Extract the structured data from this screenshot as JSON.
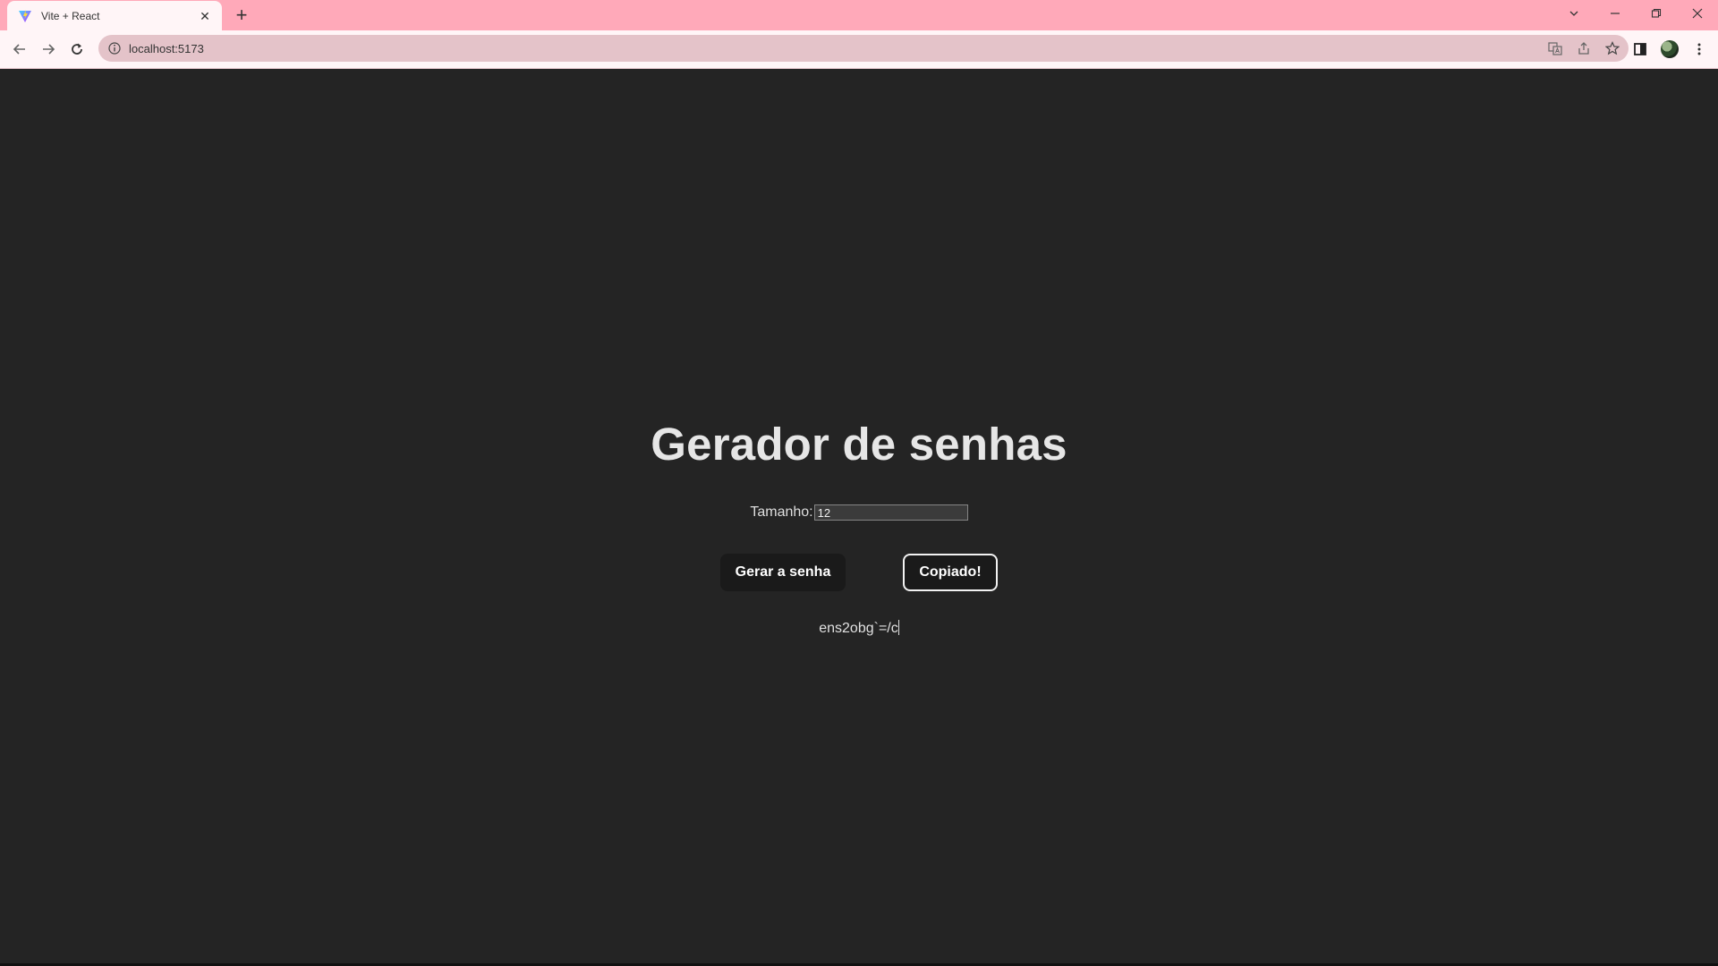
{
  "browser": {
    "tab_title": "Vite + React",
    "tab_close": "✕",
    "new_tab": "+",
    "url": "localhost:5173",
    "win_controls": [
      "⌄",
      "—",
      "❐",
      "✕"
    ],
    "colors": {
      "tabstrip": "#ffa9b9",
      "toolbar": "#fff5f7",
      "omnibox": "#e4c3c9"
    }
  },
  "app": {
    "title": "Gerador de senhas",
    "size_label": "Tamanho:",
    "size_value": "12",
    "generate_button": "Gerar a senha",
    "copy_button": "Copiado!",
    "password": "ens2obg`=/c",
    "colors": {
      "background": "#242424",
      "button": "#1a1a1a",
      "text": "#e6e6e6"
    }
  }
}
